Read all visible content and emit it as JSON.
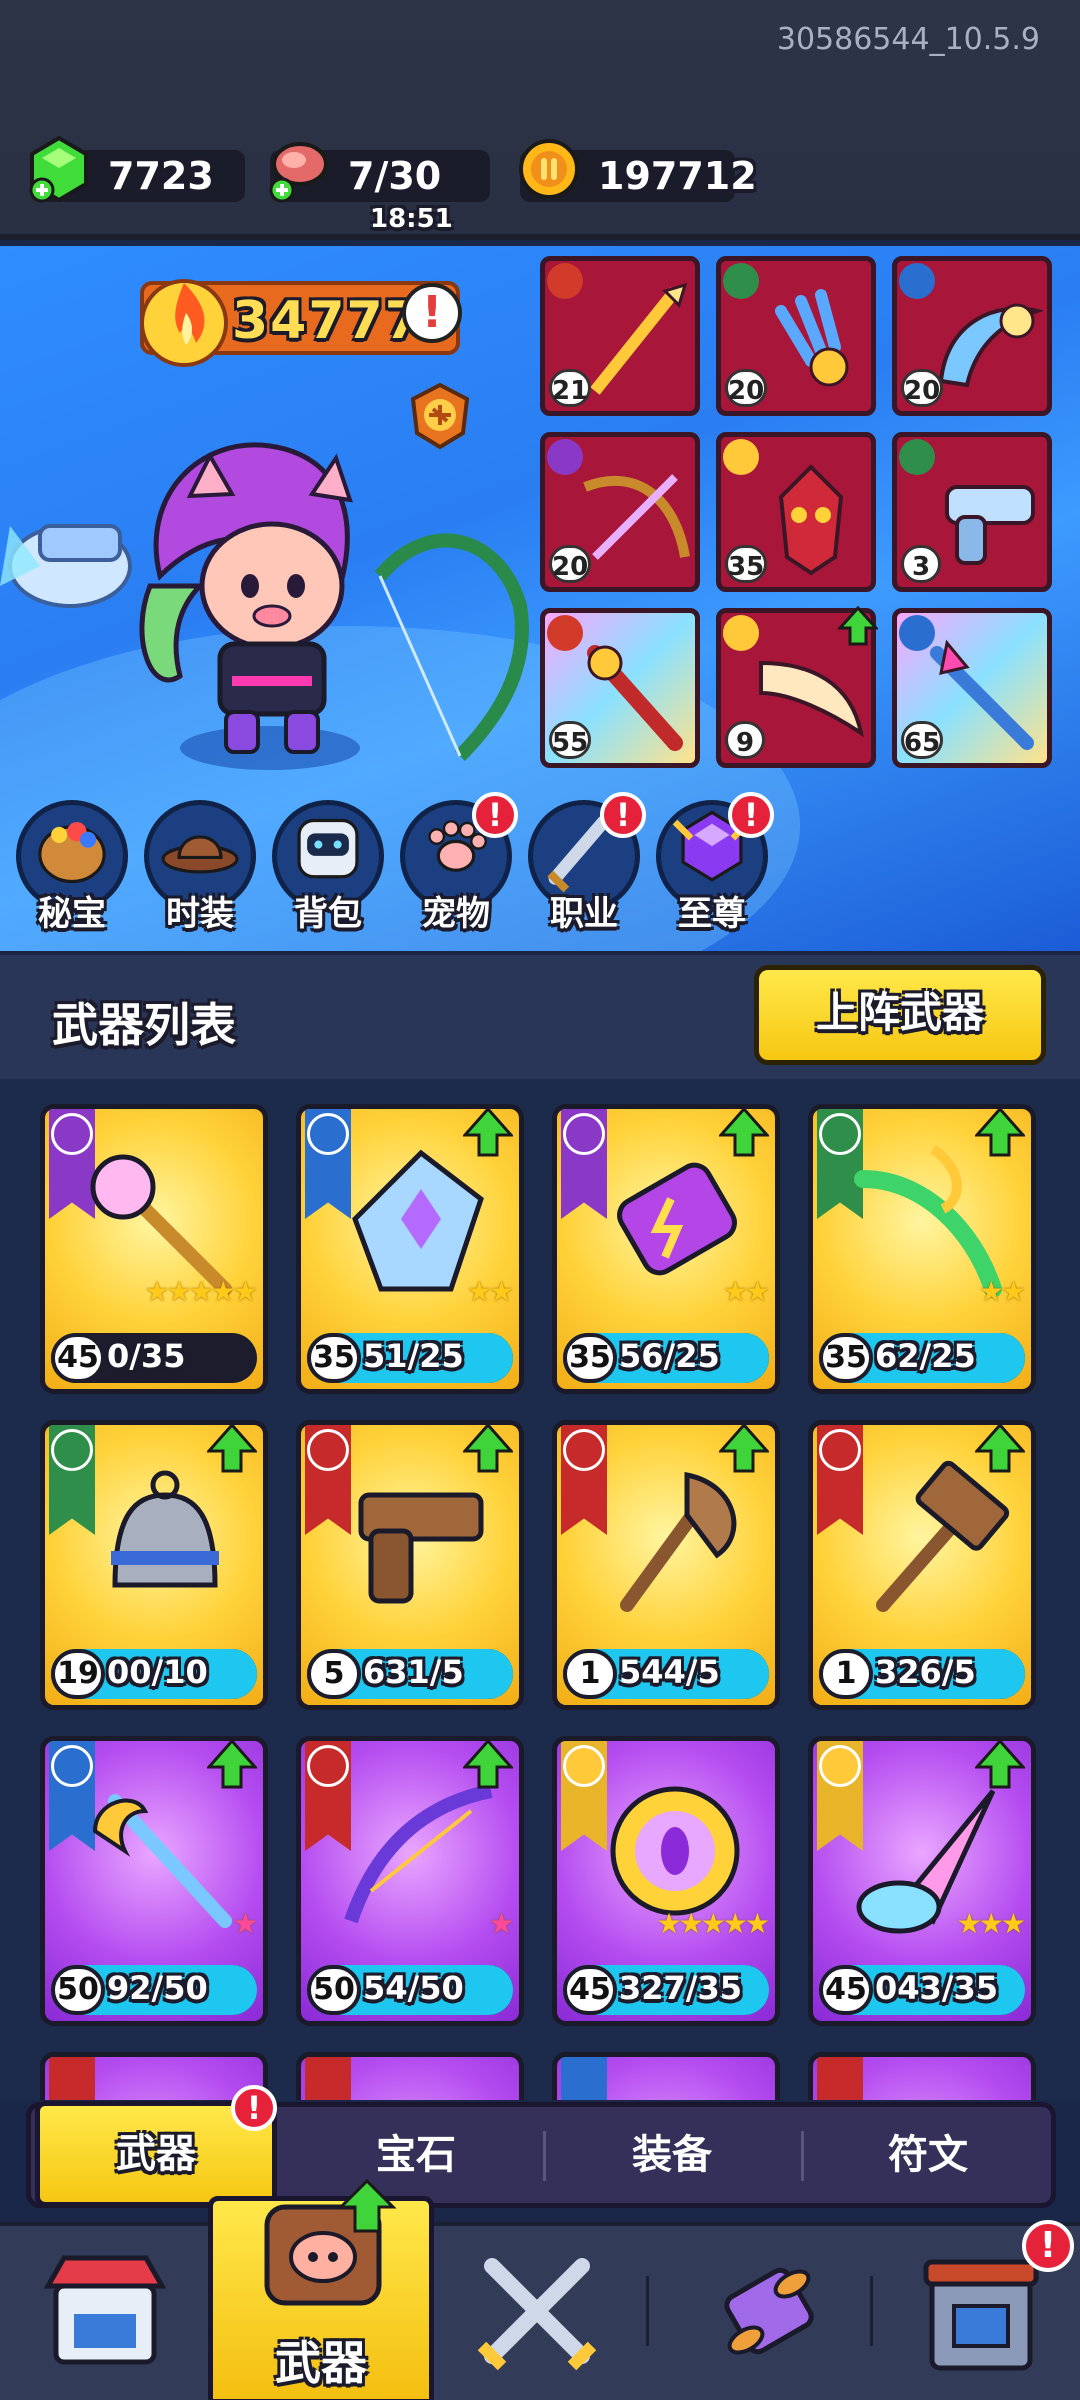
{
  "build_version": "30586544_10.5.9",
  "resources": {
    "gems": "7723",
    "energy": "7/30",
    "energy_timer": "18:51",
    "coins": "197712"
  },
  "hero": {
    "power": "34777",
    "power_info": "!",
    "equipped": [
      {
        "level": "21",
        "frame": "red",
        "element": "fire"
      },
      {
        "level": "20",
        "frame": "red",
        "element": "nature"
      },
      {
        "level": "20",
        "frame": "red",
        "element": "ice"
      },
      {
        "level": "20",
        "frame": "red",
        "element": "lightning"
      },
      {
        "level": "35",
        "frame": "red",
        "element": "holy"
      },
      {
        "level": "3",
        "frame": "red",
        "element": "wind"
      },
      {
        "level": "55",
        "frame": "rainbow",
        "element": "fire"
      },
      {
        "level": "9",
        "frame": "red",
        "element": "holy"
      },
      {
        "level": "65",
        "frame": "rainbow",
        "element": "ice"
      }
    ]
  },
  "quick_menu": [
    {
      "label": "秘宝",
      "badge": false
    },
    {
      "label": "时装",
      "badge": false
    },
    {
      "label": "背包",
      "badge": false
    },
    {
      "label": "宠物",
      "badge": true
    },
    {
      "label": "职业",
      "badge": true
    },
    {
      "label": "至尊",
      "badge": true
    }
  ],
  "list_title": "武器列表",
  "deploy_button": "上阵武器",
  "weapons": [
    {
      "level": "45",
      "progress": "0/35",
      "fill": 0.0,
      "stars": 5,
      "rarity": "gold",
      "ribbon": "purple",
      "upgradable": false
    },
    {
      "level": "35",
      "progress": "51/25",
      "fill": 1.0,
      "stars": 2,
      "rarity": "gold",
      "ribbon": "blue",
      "upgradable": true
    },
    {
      "level": "35",
      "progress": "56/25",
      "fill": 1.0,
      "stars": 2,
      "rarity": "gold",
      "ribbon": "purple",
      "upgradable": true
    },
    {
      "level": "35",
      "progress": "62/25",
      "fill": 1.0,
      "stars": 2,
      "rarity": "gold",
      "ribbon": "green",
      "upgradable": true
    },
    {
      "level": "19",
      "progress": "00/10",
      "fill": 1.0,
      "stars": 0,
      "rarity": "gold",
      "ribbon": "green",
      "upgradable": true
    },
    {
      "level": "5",
      "progress": "631/5",
      "fill": 1.0,
      "stars": 0,
      "rarity": "gold",
      "ribbon": "red",
      "upgradable": true
    },
    {
      "level": "1",
      "progress": "544/5",
      "fill": 1.0,
      "stars": 0,
      "rarity": "gold",
      "ribbon": "red",
      "upgradable": true
    },
    {
      "level": "1",
      "progress": "326/5",
      "fill": 1.0,
      "stars": 0,
      "rarity": "gold",
      "ribbon": "red",
      "upgradable": true
    },
    {
      "level": "50",
      "progress": "92/50",
      "fill": 1.0,
      "stars": 1,
      "rarity": "purple",
      "ribbon": "blue",
      "upgradable": true
    },
    {
      "level": "50",
      "progress": "54/50",
      "fill": 1.0,
      "stars": 1,
      "rarity": "purple",
      "ribbon": "red",
      "upgradable": true
    },
    {
      "level": "45",
      "progress": "327/35",
      "fill": 1.0,
      "stars": 5,
      "rarity": "purple",
      "ribbon": "gold",
      "upgradable": false
    },
    {
      "level": "45",
      "progress": "043/35",
      "fill": 1.0,
      "stars": 3,
      "rarity": "purple",
      "ribbon": "gold",
      "upgradable": true
    }
  ],
  "tabs": [
    {
      "label": "武器",
      "active": true,
      "badge": true
    },
    {
      "label": "宝石",
      "active": false,
      "badge": false
    },
    {
      "label": "装备",
      "active": false,
      "badge": false
    },
    {
      "label": "符文",
      "active": false,
      "badge": false
    }
  ],
  "nav": {
    "active_label": "武器",
    "badge": "!"
  },
  "badge_text": "!"
}
